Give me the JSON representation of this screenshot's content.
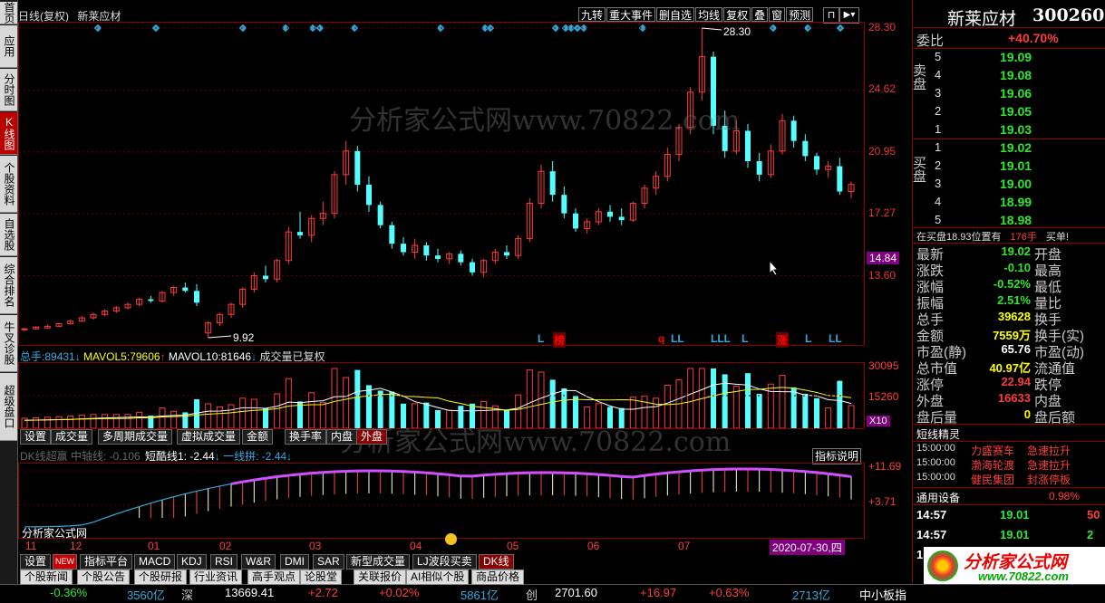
{
  "left_tabs": [
    "首页",
    "应用",
    "分时图",
    "K线图",
    "个股资料",
    "自选股",
    "综合排名",
    "牛叉诊股",
    "超级盘口"
  ],
  "active_left_tab": "K线图",
  "header": {
    "title": "日线(复权)",
    "stock": "新莱应材"
  },
  "top_buttons": [
    "九转",
    "重大事件",
    "删自选",
    "均线",
    "复权",
    "叠",
    "窗",
    "预测"
  ],
  "watermark": "分析家公式网www.70822.com",
  "main_chart": {
    "y_labels": [
      "28.30",
      "24.62",
      "20.95",
      "17.27",
      "13.60"
    ],
    "current_price_tag": "14.84",
    "high_label": "28.30",
    "low_label": "9.92",
    "signals": [
      "L",
      "榜",
      "q",
      "LL",
      "LLL",
      "L",
      "涨",
      "L",
      "LL"
    ]
  },
  "volume": {
    "header_total_label": "总手:",
    "total": "89431",
    "mavol5_label": "MAVOL5:",
    "mavol5": "79606",
    "mavol10_label": "MAVOL10:",
    "mavol10": "81646",
    "note": "成交量已复权",
    "y_labels": [
      "30095",
      "15260",
      "X10"
    ],
    "tabs": [
      "设置",
      "成交量",
      "多周期成交量",
      "虚拟成交量",
      "金额",
      "换手率",
      "内盘",
      "外盘"
    ],
    "selected_tab": "外盘"
  },
  "indicator": {
    "header_prefix": "DK线超赢 中轴线: -0.106",
    "line1_label": "短酷线1:",
    "line1": "-2.44",
    "line2_label": "一线拼:",
    "line2": "-2.44",
    "help_button": "指标说明",
    "y_labels": [
      "+11.69",
      "+3.71"
    ],
    "corner_label": "分析家公式网"
  },
  "x_axis": {
    "labels": [
      "11",
      "12",
      "01",
      "02",
      "03",
      "04",
      "05",
      "06",
      "07"
    ],
    "date_box": "2020-07-30,四"
  },
  "indicator_tabs": [
    "设置",
    "NEW",
    "指标平台",
    "MACD",
    "KDJ",
    "RSI",
    "W&R",
    "DMI",
    "SAR",
    "新型成交量",
    "LJ波段买卖",
    "DK线"
  ],
  "selected_indicator_tab": "DK线",
  "info_tabs": [
    "个股新闻",
    "个股公告",
    "个股研报",
    "行业资讯",
    "高手观点",
    "论股堂",
    "关联报价",
    "AI相似个股",
    "商品价格"
  ],
  "quote": {
    "name": "新莱应材",
    "code": "300260",
    "weibi_label": "委比",
    "weibi": "+40.70%",
    "sell_label": "卖盘",
    "sell": [
      {
        "lvl": "5",
        "price": "19.09"
      },
      {
        "lvl": "4",
        "price": "19.08"
      },
      {
        "lvl": "3",
        "price": "19.06"
      },
      {
        "lvl": "2",
        "price": "19.05"
      },
      {
        "lvl": "1",
        "price": "19.03"
      }
    ],
    "buy_label": "买盘",
    "buy": [
      {
        "lvl": "1",
        "price": "19.02"
      },
      {
        "lvl": "2",
        "price": "19.01"
      },
      {
        "lvl": "3",
        "price": "19.00"
      },
      {
        "lvl": "4",
        "price": "18.99"
      },
      {
        "lvl": "5",
        "price": "18.98"
      }
    ],
    "buy_notice_prefix": "在买盘18.93位置有",
    "buy_notice_qty": "176手",
    "buy_notice_suffix": "买单!",
    "stats": [
      {
        "l": "最新",
        "v": "19.02",
        "c": "green",
        "l2": "开盘"
      },
      {
        "l": "涨跌",
        "v": "-0.10",
        "c": "green",
        "l2": "最高"
      },
      {
        "l": "涨幅",
        "v": "-0.52%",
        "c": "green",
        "l2": "最低"
      },
      {
        "l": "振幅",
        "v": "2.51%",
        "c": "green",
        "l2": "量比"
      },
      {
        "l": "总手",
        "v": "39628",
        "c": "yellow",
        "l2": "换手"
      },
      {
        "l": "金额",
        "v": "7559万",
        "c": "yellow",
        "l2": "换手(实)"
      },
      {
        "l": "市盈(静)",
        "v": "65.76",
        "c": "white",
        "l2": "市盈(动)"
      },
      {
        "l": "总市值",
        "v": "40.97亿",
        "c": "yellow",
        "l2": "流通值"
      },
      {
        "l": "涨停",
        "v": "22.94",
        "c": "red",
        "l2": "跌停"
      },
      {
        "l": "外盘",
        "v": "16633",
        "c": "red",
        "l2": "内盘"
      },
      {
        "l": "盘后量",
        "v": "0",
        "c": "yellow",
        "l2": "盘后额"
      }
    ],
    "elves_label": "短线精灵",
    "elves": [
      {
        "t": "15:00:00",
        "n": "力盛赛车",
        "e": "急速拉升"
      },
      {
        "t": "15:00:00",
        "n": "渤海轮渡",
        "e": "急速拉升"
      },
      {
        "t": "15:00:00",
        "n": "健民集团",
        "e": "封涨停板"
      }
    ],
    "sector_label": "通用设备",
    "sector_pct": "0.98%",
    "ticks": [
      {
        "t": "14:57",
        "p": "19.01",
        "q": "50"
      },
      {
        "t": "14:57",
        "p": "19.01",
        "q": "2"
      },
      {
        "t": "15:00",
        "p": "19.02",
        "q": ""
      }
    ],
    "logo_text": "分析家公式网",
    "logo_url": "www.70822.com"
  },
  "status": {
    "sh_pct": "-0.36%",
    "sh_amt": "3560亿",
    "sz_label": "深",
    "sz_idx": "13669.41",
    "sz_chg": "+2.72",
    "sz_pct": "+0.02%",
    "sz_amt": "5861亿",
    "cy_label": "创",
    "cy_idx": "2701.60",
    "cy_chg": "+16.97",
    "cy_pct": "+0.63%",
    "cy_amt": "2713亿",
    "board": "中小板指"
  },
  "colors": {
    "up": "#ff3b3b",
    "down": "#54ffff",
    "ma5": "#ffffff",
    "ma10": "#ffff00",
    "frame": "#8b0000"
  },
  "chart_data": {
    "type": "candlestick",
    "ylim": [
      9.92,
      28.3
    ],
    "candles": [
      [
        10.4,
        10.5,
        10.3,
        10.45
      ],
      [
        10.45,
        10.6,
        10.4,
        10.55
      ],
      [
        10.5,
        10.7,
        10.45,
        10.6
      ],
      [
        10.6,
        10.8,
        10.55,
        10.75
      ],
      [
        10.75,
        11.0,
        10.7,
        10.9
      ],
      [
        10.9,
        11.2,
        10.85,
        11.1
      ],
      [
        11.1,
        11.4,
        11.0,
        11.3
      ],
      [
        11.3,
        11.6,
        11.2,
        11.5
      ],
      [
        11.5,
        11.8,
        11.4,
        11.7
      ],
      [
        11.7,
        12.0,
        11.6,
        11.9
      ],
      [
        11.9,
        12.3,
        11.8,
        12.2
      ],
      [
        12.2,
        12.4,
        12.0,
        12.1
      ],
      [
        12.1,
        12.7,
        12.0,
        12.6
      ],
      [
        12.6,
        13.0,
        12.4,
        12.9
      ],
      [
        12.9,
        13.2,
        12.6,
        12.7
      ],
      [
        12.7,
        13.1,
        11.8,
        12.0
      ],
      [
        10.2,
        10.9,
        9.92,
        10.8
      ],
      [
        10.8,
        11.4,
        10.6,
        11.3
      ],
      [
        11.3,
        12.0,
        11.1,
        11.9
      ],
      [
        11.9,
        12.9,
        11.7,
        12.8
      ],
      [
        12.8,
        13.8,
        12.6,
        13.6
      ],
      [
        13.6,
        14.2,
        13.2,
        13.4
      ],
      [
        13.4,
        14.6,
        13.2,
        14.5
      ],
      [
        14.5,
        16.5,
        14.3,
        16.2
      ],
      [
        16.2,
        17.4,
        15.8,
        16.0
      ],
      [
        16.0,
        17.2,
        15.6,
        17.0
      ],
      [
        17.0,
        18.0,
        16.6,
        17.3
      ],
      [
        17.3,
        19.8,
        17.0,
        19.6
      ],
      [
        19.6,
        21.6,
        19.0,
        21.0
      ],
      [
        21.0,
        21.3,
        18.6,
        19.0
      ],
      [
        19.0,
        19.5,
        17.4,
        17.8
      ],
      [
        17.8,
        18.0,
        16.4,
        16.6
      ],
      [
        16.6,
        16.8,
        15.2,
        15.5
      ],
      [
        15.5,
        15.9,
        14.8,
        15.0
      ],
      [
        15.0,
        15.8,
        14.6,
        15.4
      ],
      [
        15.4,
        15.6,
        14.5,
        14.8
      ],
      [
        14.8,
        15.2,
        14.4,
        14.6
      ],
      [
        14.6,
        15.0,
        14.3,
        14.9
      ],
      [
        14.9,
        15.1,
        14.2,
        14.4
      ],
      [
        14.4,
        14.6,
        13.6,
        13.8
      ],
      [
        13.8,
        14.6,
        13.5,
        14.5
      ],
      [
        14.5,
        15.2,
        14.3,
        15.0
      ],
      [
        15.0,
        15.4,
        14.6,
        14.8
      ],
      [
        14.8,
        16.0,
        14.6,
        15.8
      ],
      [
        15.8,
        18.2,
        15.6,
        17.9
      ],
      [
        17.9,
        20.2,
        17.6,
        19.8
      ],
      [
        19.8,
        20.4,
        18.0,
        18.4
      ],
      [
        18.4,
        18.9,
        17.0,
        17.3
      ],
      [
        17.3,
        17.6,
        16.2,
        16.4
      ],
      [
        16.4,
        17.0,
        16.1,
        16.8
      ],
      [
        16.8,
        17.6,
        16.6,
        17.4
      ],
      [
        17.4,
        17.8,
        16.8,
        17.1
      ],
      [
        17.1,
        17.6,
        16.6,
        16.9
      ],
      [
        16.9,
        18.0,
        16.8,
        17.9
      ],
      [
        17.9,
        19.0,
        17.6,
        18.8
      ],
      [
        18.8,
        19.8,
        18.4,
        19.5
      ],
      [
        19.5,
        21.2,
        19.2,
        20.8
      ],
      [
        20.8,
        22.6,
        20.4,
        22.4
      ],
      [
        22.4,
        24.8,
        22.0,
        24.5
      ],
      [
        24.5,
        28.3,
        24.0,
        26.6
      ],
      [
        26.6,
        26.9,
        22.0,
        22.5
      ],
      [
        22.5,
        23.4,
        20.6,
        21.0
      ],
      [
        21.0,
        22.8,
        20.8,
        22.2
      ],
      [
        22.2,
        22.6,
        20.0,
        20.4
      ],
      [
        20.4,
        20.9,
        19.2,
        19.6
      ],
      [
        19.6,
        21.4,
        19.4,
        21.0
      ],
      [
        21.0,
        23.2,
        20.8,
        22.8
      ],
      [
        22.8,
        23.1,
        21.2,
        21.6
      ],
      [
        21.6,
        22.0,
        20.4,
        20.7
      ],
      [
        20.7,
        20.9,
        19.6,
        19.9
      ],
      [
        19.9,
        20.4,
        19.4,
        20.1
      ],
      [
        20.1,
        20.6,
        18.4,
        18.6
      ],
      [
        18.6,
        19.2,
        18.2,
        19.02
      ]
    ]
  }
}
